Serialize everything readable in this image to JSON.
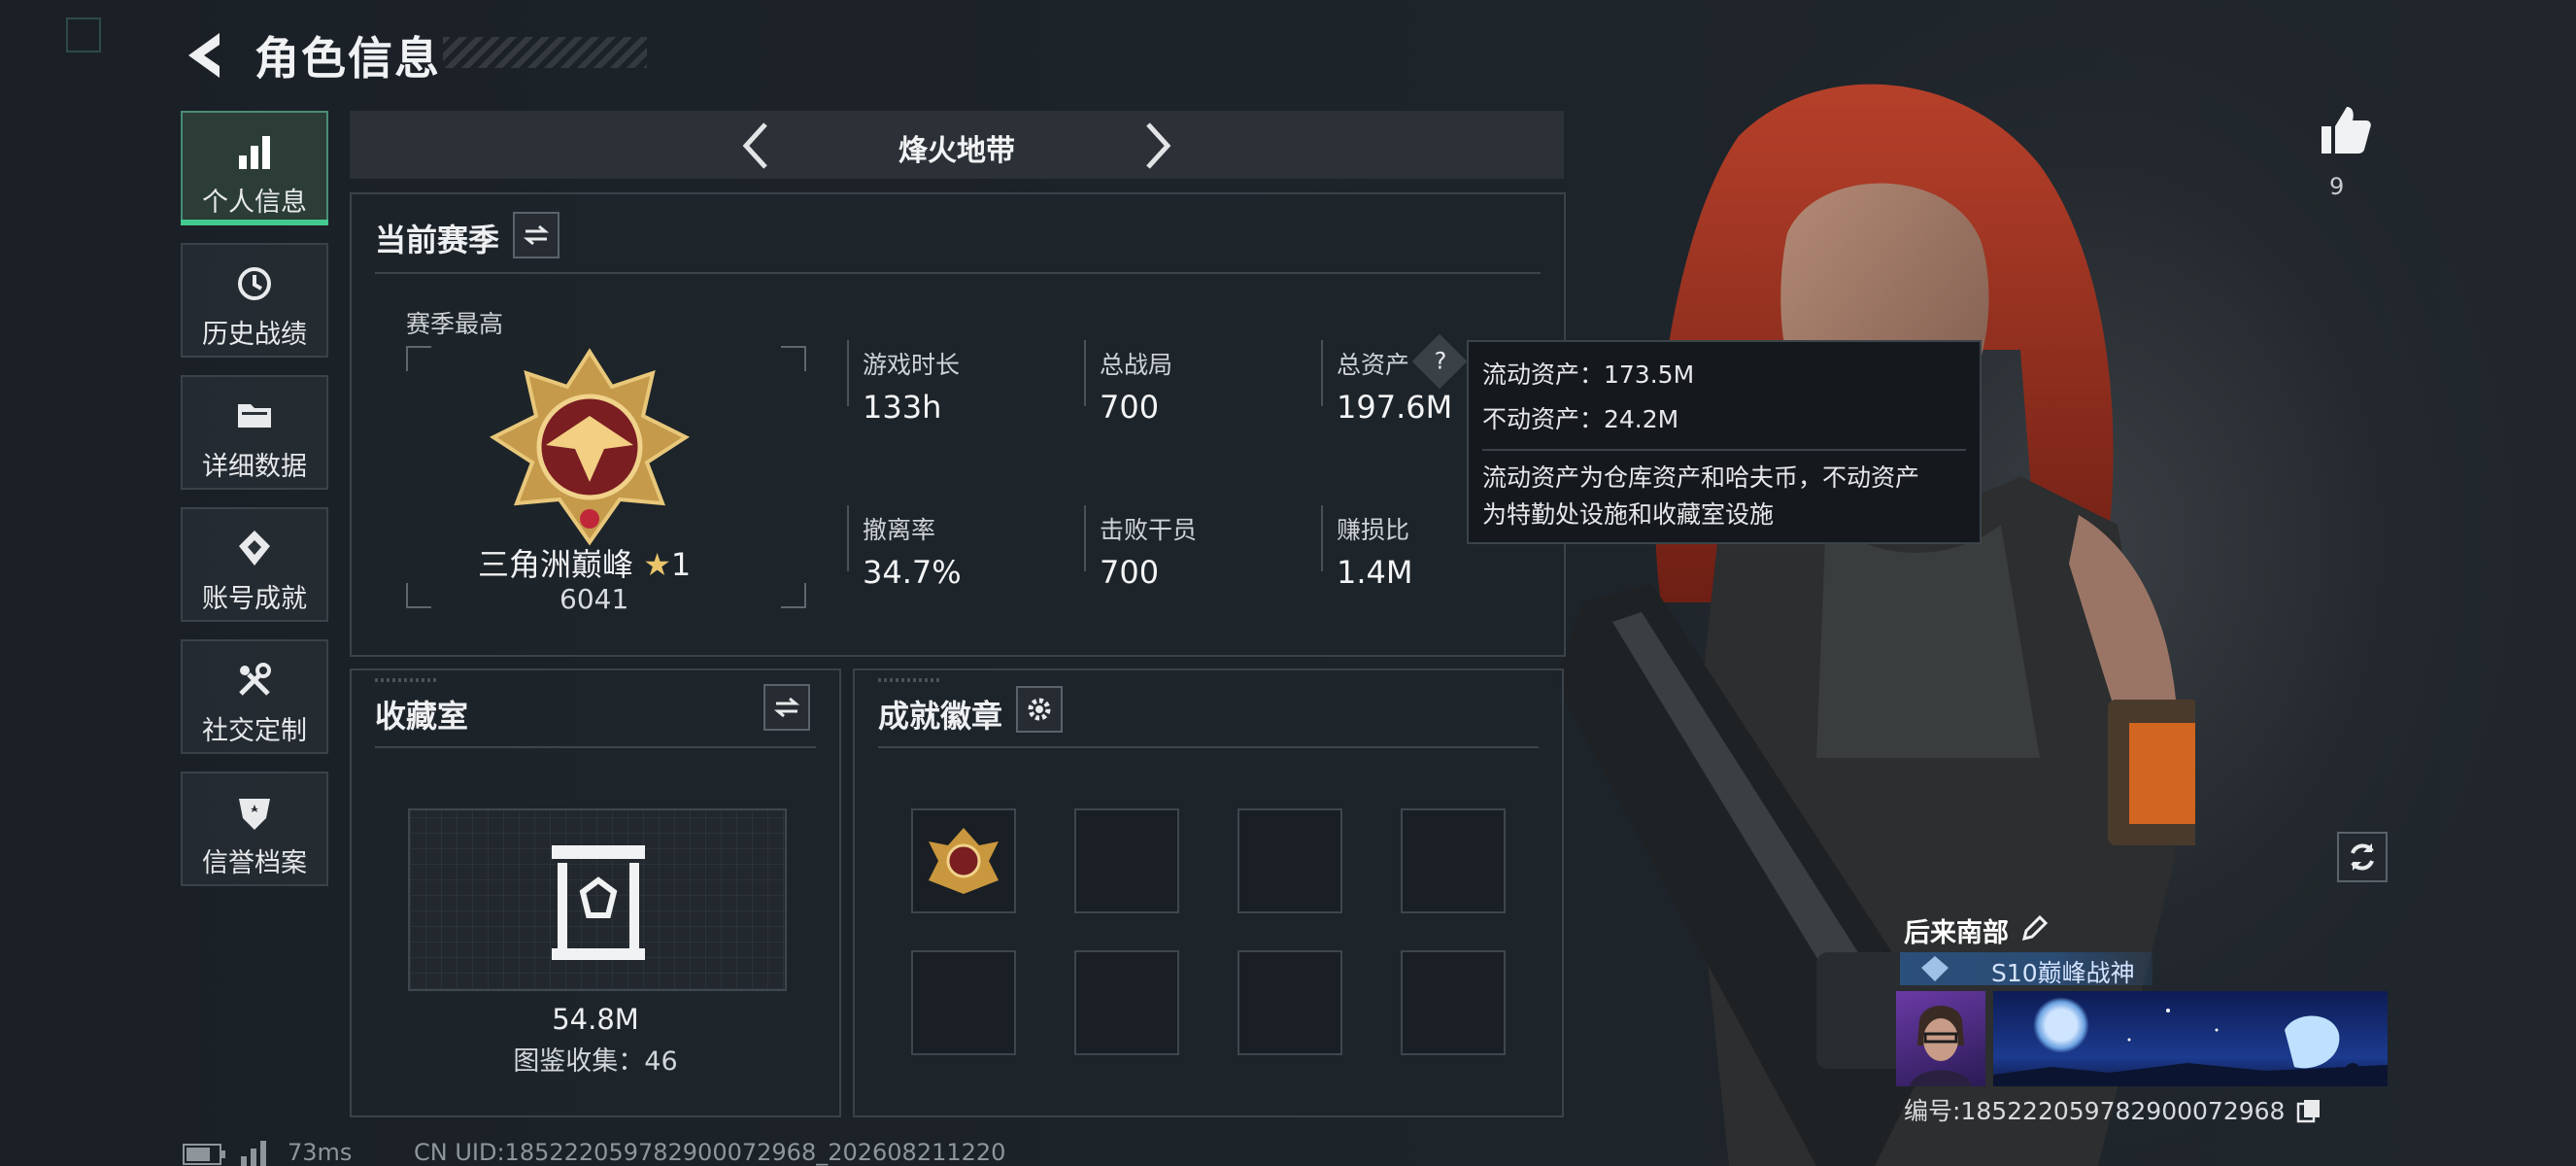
{
  "header": {
    "title": "角色信息"
  },
  "sidebar": {
    "items": [
      {
        "label": "个人信息",
        "icon": "bar-chart-icon",
        "active": true
      },
      {
        "label": "历史战绩",
        "icon": "history-clock-icon",
        "active": false
      },
      {
        "label": "详细数据",
        "icon": "folder-icon",
        "active": false
      },
      {
        "label": "账号成就",
        "icon": "achievement-diamond-icon",
        "active": false
      },
      {
        "label": "社交定制",
        "icon": "tools-icon",
        "active": false
      },
      {
        "label": "信誉档案",
        "icon": "shield-star-icon",
        "active": false
      }
    ]
  },
  "mode": {
    "name": "烽火地带"
  },
  "season": {
    "title": "当前赛季",
    "best_label": "赛季最高",
    "rank_name": "三角洲巅峰",
    "rank_stars": "1",
    "rank_score": "6041",
    "stats": [
      {
        "label": "游戏时长",
        "value": "133h"
      },
      {
        "label": "总战局",
        "value": "700"
      },
      {
        "label": "总资产",
        "value": "197.6M"
      },
      {
        "label": "撤离率",
        "value": "34.7%"
      },
      {
        "label": "击败干员",
        "value": "700"
      },
      {
        "label": "赚损比",
        "value": "1.4M"
      }
    ]
  },
  "tooltip": {
    "liquid": "流动资产：173.5M",
    "fixed": "不动资产：24.2M",
    "desc_line1": "流动资产为仓库资产和哈夫币，不动资产",
    "desc_line2": "为特勤处设施和收藏室设施"
  },
  "collection": {
    "title": "收藏室",
    "value": "54.8M",
    "count_text": "图鉴收集：46"
  },
  "achievements": {
    "title": "成就徽章"
  },
  "profile": {
    "likes": "9",
    "player_name": "后来南部",
    "title_badge": "S10巅峰战神",
    "uid_text": "编号:18522205978290007296​8"
  },
  "status": {
    "ping": "73ms",
    "cn_uid": "CN UID:18522205978290007296​8_202608211220"
  },
  "colors": {
    "accent": "#43c98f",
    "panel_border": "#3b434a",
    "background": "#1b2127"
  }
}
